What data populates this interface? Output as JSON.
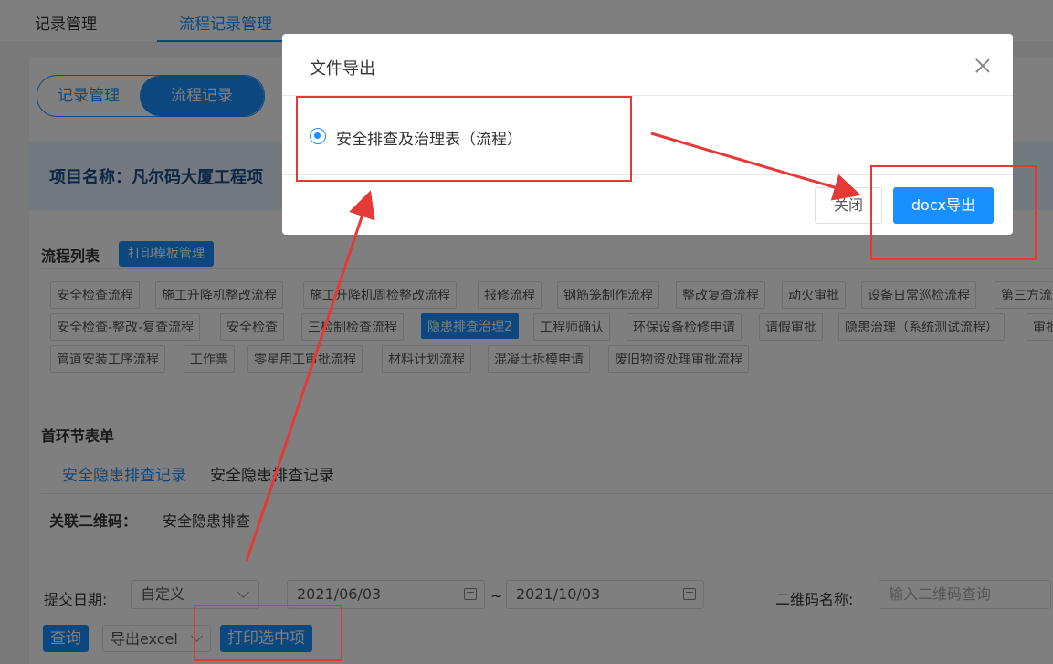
{
  "top_tabs": [
    "记录管理",
    "流程记录管理"
  ],
  "segment": {
    "left": "记录管理",
    "right": "流程记录"
  },
  "project_title": "项目名称：凡尔码大厦工程项",
  "flow_list": {
    "label": "流程列表",
    "template_button": "打印模板管理",
    "chips": [
      "安全检查流程",
      "施工升降机整改流程",
      "施工升降机周检整改流程",
      "报修流程",
      "钢筋笼制作流程",
      "整改复查流程",
      "动火审批",
      "设备日常巡检流程",
      "第三方流",
      "安全检查-整改-复查流程",
      "安全检查",
      "三检制检查流程",
      "隐患排查治理2",
      "工程师确认",
      "环保设备检修申请",
      "请假审批",
      "隐患治理（系统测试流程）",
      "审批",
      "管道安装工序流程",
      "工作票",
      "零星用工审批流程",
      "材料计划流程",
      "混凝土拆模申请",
      "废旧物资处理审批流程"
    ],
    "active_chip": "隐患排查治理2"
  },
  "first_form": {
    "label": "首环节表单",
    "link": "安全隐患排查记录",
    "text": "安全隐患排查记录",
    "qr_label": "关联二维码：",
    "qr_value": "安全隐患排查"
  },
  "filter": {
    "date_label": "提交日期:",
    "date_mode": "自定义",
    "start_date": "2021/06/03",
    "separator": "~",
    "end_date": "2021/10/03",
    "qr_name_label": "二维码名称:",
    "qr_placeholder": "输入二维码查询",
    "query_button": "查询",
    "export_excel": "导出excel",
    "print_selected": "打印选中项"
  },
  "dialog": {
    "title": "文件导出",
    "option_label": "安全排查及治理表（流程）",
    "close_button": "关闭",
    "export_button": "docx导出"
  },
  "colors": {
    "primary": "#1890ff",
    "annotation": "#e53935"
  }
}
